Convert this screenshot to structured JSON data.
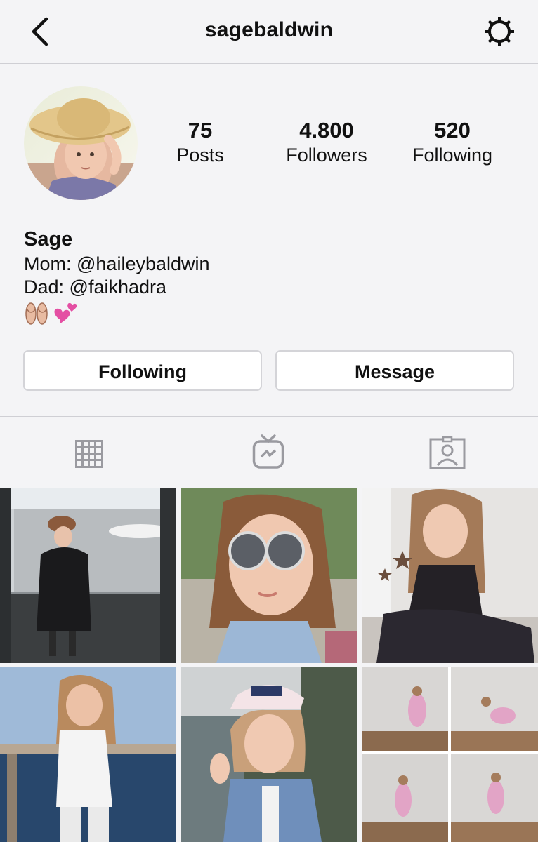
{
  "header": {
    "username": "sagebaldwin",
    "back_icon": "chevron-left-icon",
    "settings_icon": "gear-icon"
  },
  "profile": {
    "stats": {
      "posts": {
        "value": "75",
        "label": "Posts"
      },
      "followers": {
        "value": "4.800",
        "label": "Followers"
      },
      "following": {
        "value": "520",
        "label": "Following"
      }
    },
    "name": "Sage",
    "bio_lines": [
      "Mom: @haileybaldwin",
      "Dad: @faikhadra"
    ],
    "bio_emoji": "🩰💕"
  },
  "actions": {
    "following_label": "Following",
    "message_label": "Message"
  },
  "tabs": [
    {
      "icon": "grid-icon",
      "active": false
    },
    {
      "icon": "igtv-icon",
      "active": false
    },
    {
      "icon": "tagged-photos-icon",
      "active": false
    }
  ],
  "colors": {
    "background": "#f4f4f6",
    "divider": "#cfcfd4",
    "icon_gray": "#9a9aa0"
  }
}
